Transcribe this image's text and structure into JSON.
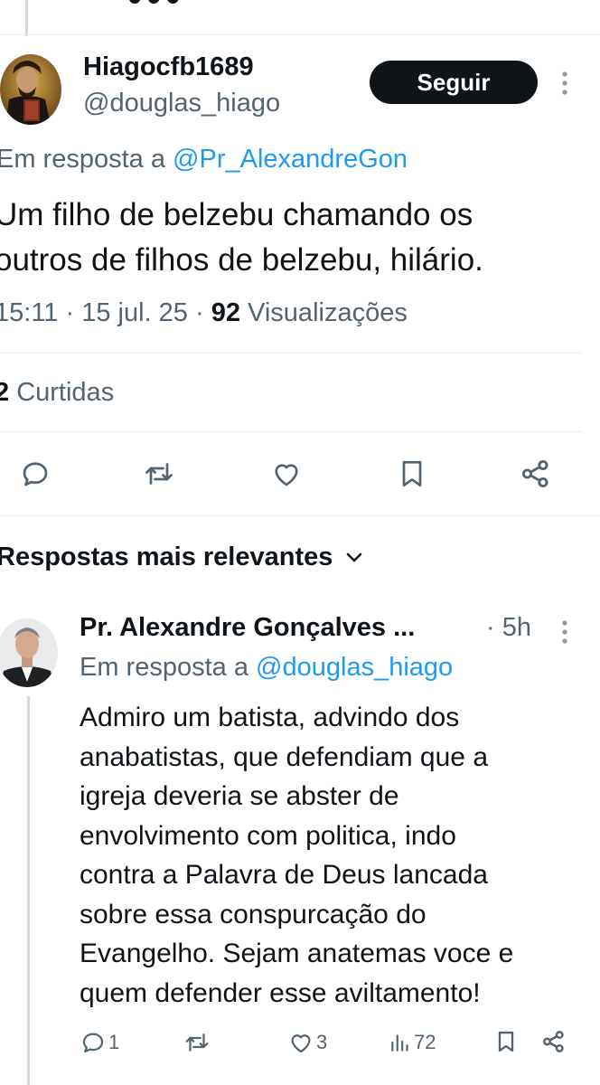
{
  "top_partial": "",
  "tweet": {
    "display_name": "Hiagocfb1689",
    "handle": "@douglas_hiago",
    "follow_label": "Seguir",
    "reply_prefix": "Em resposta a",
    "reply_to": "@Pr_AlexandreGon",
    "text_line1": "Um filho de belzebu chamando os",
    "text_line2": "outros de filhos de belzebu, hilário.",
    "time": "15:11",
    "sep1": "·",
    "date": "15 jul. 25",
    "sep2": "·",
    "views_count": "92",
    "views_label": "Visualizações",
    "likes_count": "2",
    "likes_label": "Curtidas"
  },
  "sort": {
    "label": "Respostas mais relevantes"
  },
  "reply": {
    "display_name": "Pr. Alexandre Gonçalves ...",
    "time": "· 5h",
    "reply_prefix": "Em resposta a",
    "reply_to": "@douglas_hiago",
    "lines": [
      "Admiro um batista, advindo dos",
      "anabatistas, que defendiam que a",
      "igreja deveria se abster de",
      "envolvimento com politica, indo",
      "contra a Palavra de Deus lancada",
      "sobre essa conspurcação do",
      "Evangelho. Sejam anatemas voce e",
      "quem defender esse aviltamento!"
    ],
    "reply_count": "1",
    "like_count": "3",
    "view_count": "72"
  },
  "colors": {
    "link": "#1d9bf0",
    "muted": "#536471",
    "text": "#0f1419"
  },
  "icons": [
    "more-icon",
    "reply-icon",
    "retweet-icon",
    "like-icon",
    "bookmark-icon",
    "share-icon",
    "chevron-down-icon",
    "views-icon"
  ]
}
